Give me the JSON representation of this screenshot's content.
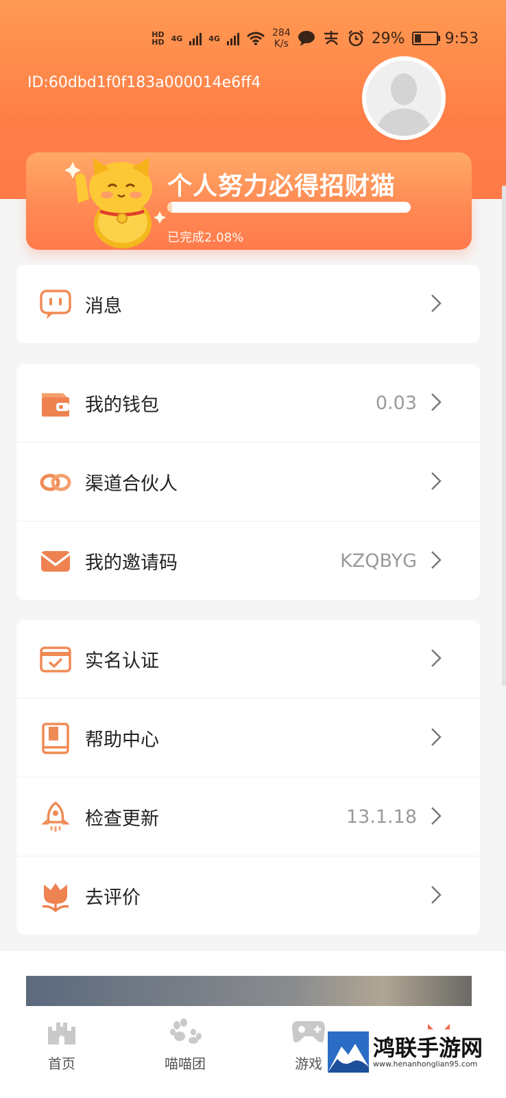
{
  "status_bar": {
    "hd1": "HD",
    "hd2": "HD",
    "net1": "4G",
    "net2": "4G",
    "speed_value": "284",
    "speed_unit": "K/s",
    "battery": "29%",
    "battery_level": 0.29,
    "time": "9:53"
  },
  "profile": {
    "id": "ID:60dbd1f0f183a000014e6ff4"
  },
  "banner": {
    "title": "个人努力必得招财猫",
    "progress": 0.0208,
    "progress_text": "已完成2.08%"
  },
  "colors": {
    "accent": "#ff7e47",
    "icon": "#f08a55"
  },
  "menu_groups": [
    [
      {
        "icon": "message-icon",
        "label": "消息",
        "value": ""
      }
    ],
    [
      {
        "icon": "wallet-icon",
        "label": "我的钱包",
        "value": "0.03"
      },
      {
        "icon": "partner-icon",
        "label": "渠道合伙人",
        "value": ""
      },
      {
        "icon": "invite-icon",
        "label": "我的邀请码",
        "value": "KZQBYG"
      }
    ],
    [
      {
        "icon": "verify-icon",
        "label": "实名认证",
        "value": ""
      },
      {
        "icon": "help-icon",
        "label": "帮助中心",
        "value": ""
      },
      {
        "icon": "update-icon",
        "label": "检查更新",
        "value": "13.1.18"
      },
      {
        "icon": "rate-icon",
        "label": "去评价",
        "value": ""
      }
    ]
  ],
  "tabbar": [
    {
      "icon": "home-icon",
      "label": "首页"
    },
    {
      "icon": "paw-icon",
      "label": "喵喵团"
    },
    {
      "icon": "game-icon",
      "label": "游戏"
    }
  ],
  "watermark": {
    "title": "鸿联手游网",
    "url": "www.henanhonglian95.com"
  }
}
